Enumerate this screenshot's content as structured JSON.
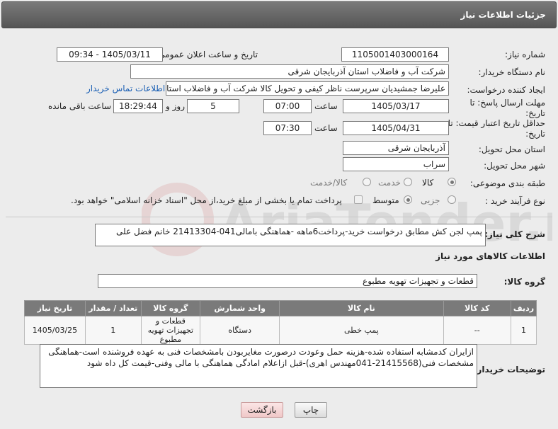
{
  "header": {
    "title": "جزئیات اطلاعات نیاز"
  },
  "fields": {
    "need_number_label": "شماره نیاز:",
    "need_number": "1105001403000164",
    "announce_label": "تاریخ و ساعت اعلان عمومی:",
    "announce_value": "1405/03/11 - 09:34",
    "buyer_org_label": "نام دستگاه خریدار:",
    "buyer_org": "شرکت آب و فاضلاب استان آذربایجان شرقی",
    "creator_label": "ایجاد کننده درخواست:",
    "creator": "علیرضا جمشیدیان سرپرست ناظر کیفی و تحویل کالا شرکت آب و فاضلاب استان",
    "buyer_contact_link": "اطلاعات تماس خریدار",
    "deadline_label": "مهلت ارسال پاسخ: تا تاریخ:",
    "deadline_date": "1405/03/17",
    "time_label": "ساعت",
    "deadline_time": "07:00",
    "days_value": "5",
    "days_label": "روز و",
    "remaining_time": "18:29:44",
    "remaining_label": "ساعت باقی مانده",
    "price_validity_label": "حداقل تاریخ اعتبار قیمت: تا تاریخ:",
    "price_validity_date": "1405/04/31",
    "price_validity_time": "07:30",
    "province_label": "استان محل تحویل:",
    "province": "آذربایجان شرقی",
    "city_label": "شهر محل تحویل:",
    "city": "سراب",
    "category_label": "طبقه بندی موضوعی:",
    "category_options": [
      "کالا",
      "خدمت",
      "کالا/خدمت"
    ],
    "process_label": "نوع فرآیند خرید :",
    "process_options": [
      "جزیی",
      "متوسط"
    ],
    "payment_note": "پرداخت تمام یا بخشی از مبلغ خرید،از محل \"اسناد خزانه اسلامی\" خواهد بود.",
    "general_desc_label": "شرح کلی نیاز:",
    "general_desc": "پمپ لجن کش مطابق درخواست خرید-پرداخت6ماهه -هماهنگی بامالی041-21413304 خانم فضل علی",
    "goods_info_title": "اطلاعات کالاهای مورد نیاز",
    "goods_group_label": "گروه کالا:",
    "goods_group": "قطعات و تجهیزات تهویه مطبوع",
    "buyer_notes_label": "توضیحات خریدار:",
    "buyer_notes": "ازایران کدمشابه استفاده شده-هزینه حمل وعودت درصورت مغایربودن بامشخصات فنی به عهده فروشنده است-هماهنگی مشخصات فنی(21415568-041مهندس اهری)-قبل ازاعلام امادگی  هماهنگی با مالی وفنی-قیمت کل داه شود"
  },
  "table": {
    "headers": [
      "ردیف",
      "کد کالا",
      "نام کالا",
      "واحد شمارش",
      "گروه کالا",
      "تعداد / مقدار",
      "تاریخ نیاز"
    ],
    "rows": [
      [
        "1",
        "--",
        "پمپ خطی",
        "دستگاه",
        "قطعات و تجهیزات تهویه مطبوع",
        "1",
        "1405/03/25"
      ]
    ]
  },
  "buttons": {
    "print": "چاپ",
    "back": "بازگشت"
  },
  "watermark": "AriaTender.neT",
  "colors": {
    "header": "#666666",
    "link": "#1a5fb4",
    "back_button": "#f0c8c8"
  }
}
